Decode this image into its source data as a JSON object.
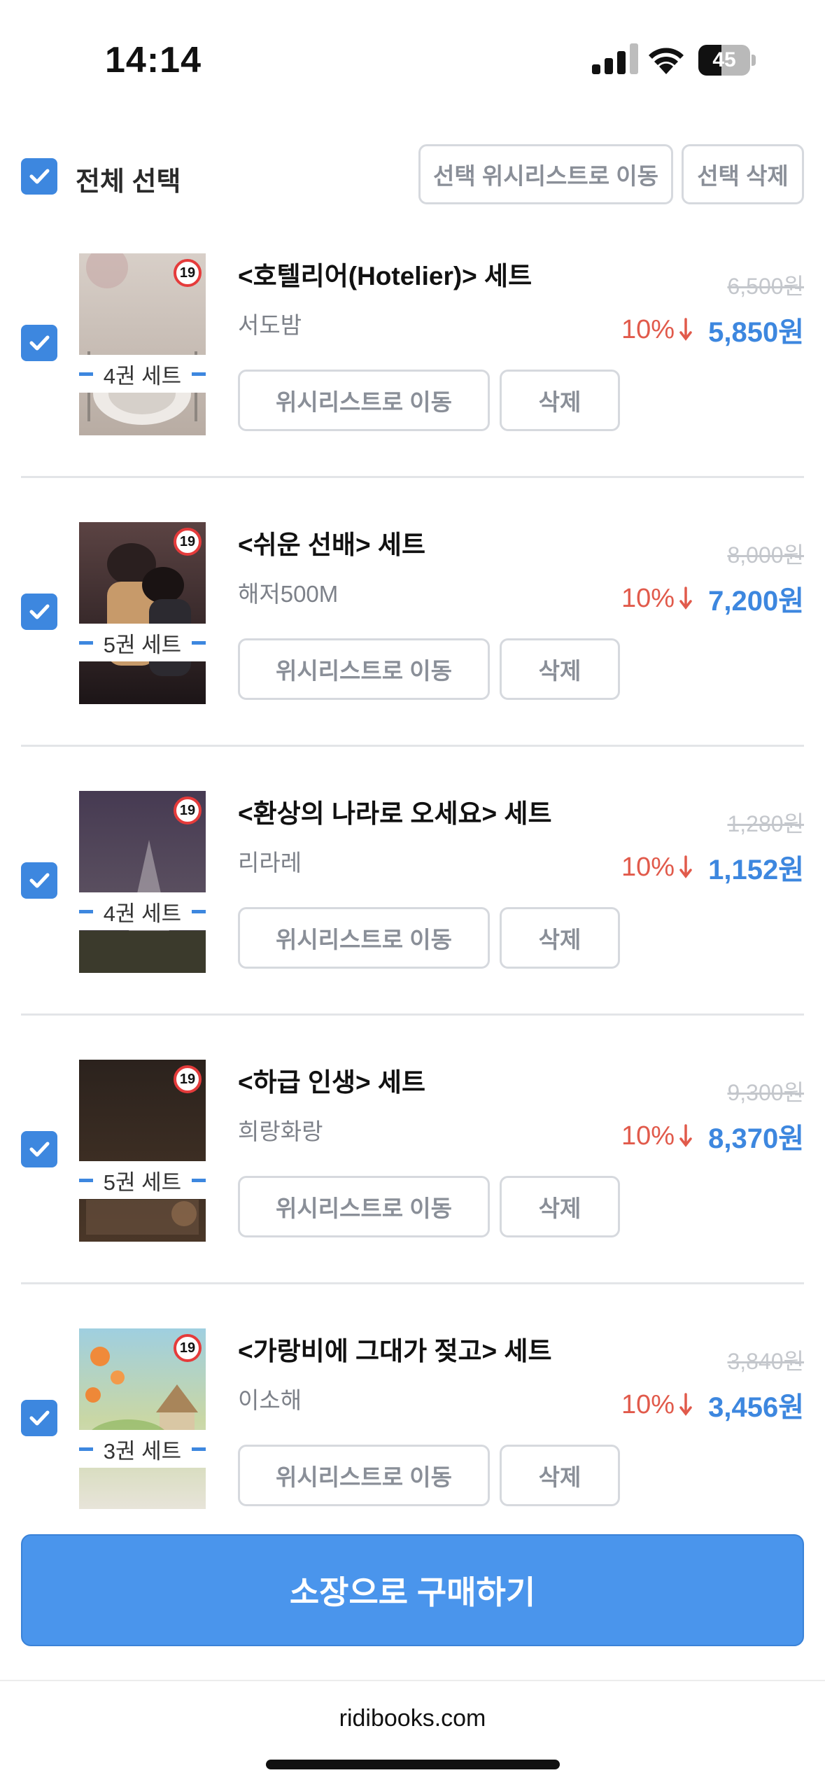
{
  "status_bar": {
    "time": "14:14",
    "battery": "45",
    "battery_level": 0.45
  },
  "toolbar": {
    "select_all_label": "전체 선택",
    "select_all_checked": true,
    "move_selected_wishlist": "선택 위시리스트로 이동",
    "delete_selected": "선택 삭제"
  },
  "items": [
    {
      "title": "<호텔리어(Hotelier)> 세트",
      "author": "서도밤",
      "set_count": "4권 세트",
      "age": "19",
      "original_price": "6,500원",
      "discount": "10%",
      "final_price": "5,850원",
      "checked": true,
      "move_wishlist": "위시리스트로 이동",
      "delete": "삭제"
    },
    {
      "title": "<쉬운 선배> 세트",
      "author": "해저500M",
      "set_count": "5권 세트",
      "age": "19",
      "original_price": "8,000원",
      "discount": "10%",
      "final_price": "7,200원",
      "checked": true,
      "move_wishlist": "위시리스트로 이동",
      "delete": "삭제"
    },
    {
      "title": "<환상의 나라로 오세요> 세트",
      "author": "리라레",
      "set_count": "4권 세트",
      "age": "19",
      "original_price": "1,280원",
      "discount": "10%",
      "final_price": "1,152원",
      "checked": true,
      "move_wishlist": "위시리스트로 이동",
      "delete": "삭제"
    },
    {
      "title": "<하급 인생> 세트",
      "author": "희랑화랑",
      "set_count": "5권 세트",
      "age": "19",
      "original_price": "9,300원",
      "discount": "10%",
      "final_price": "8,370원",
      "checked": true,
      "move_wishlist": "위시리스트로 이동",
      "delete": "삭제"
    },
    {
      "title": "<가랑비에 그대가 젖고> 세트",
      "author": "이소해",
      "set_count": "3권 세트",
      "age": "19",
      "original_price": "3,840원",
      "discount": "10%",
      "final_price": "3,456원",
      "checked": true,
      "move_wishlist": "위시리스트로 이동",
      "delete": "삭제"
    }
  ],
  "purchase_button": "소장으로 구매하기",
  "footer": {
    "url": "ridibooks.com"
  },
  "colors": {
    "accent": "#3d87df",
    "discount": "#e15a4b",
    "buy_button": "#4a95ec",
    "age_ring": "#e53b3b"
  },
  "icons": [
    "signal-icon",
    "wifi-icon",
    "battery-icon",
    "checkbox-check-icon",
    "down-arrow-icon"
  ]
}
